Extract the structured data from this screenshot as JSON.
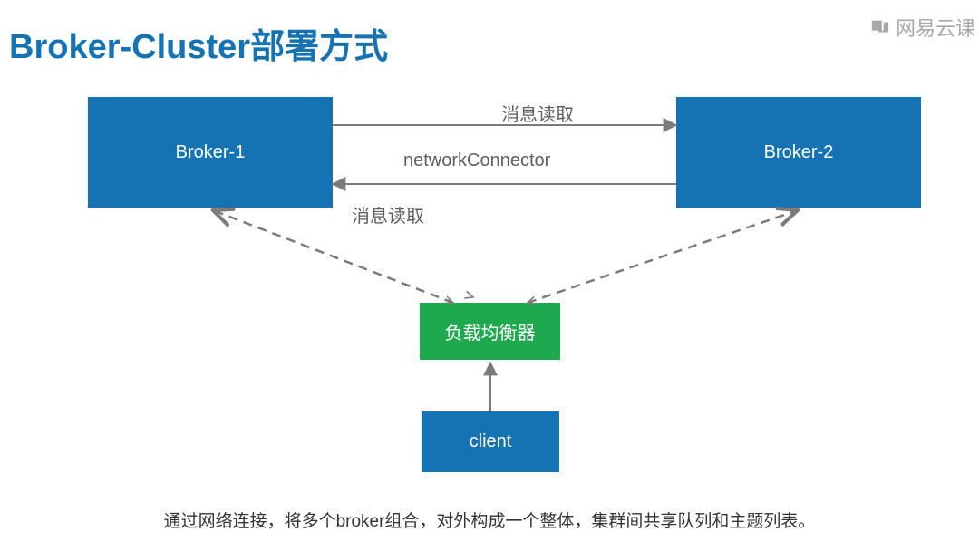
{
  "title": "Broker-Cluster部署方式",
  "watermark": "网易云课",
  "nodes": {
    "broker1": "Broker-1",
    "broker2": "Broker-2",
    "load_balancer": "负载均衡器",
    "client": "client"
  },
  "labels": {
    "top": "消息读取",
    "mid": "networkConnector",
    "bottom": "消息读取"
  },
  "caption": "通过网络连接，将多个broker组合，对外构成一个整体，集群间共享队列和主题列表。",
  "colors": {
    "accent_blue": "#1573b3",
    "accent_green": "#1fa94f",
    "arrow": "#7b7b7b"
  }
}
